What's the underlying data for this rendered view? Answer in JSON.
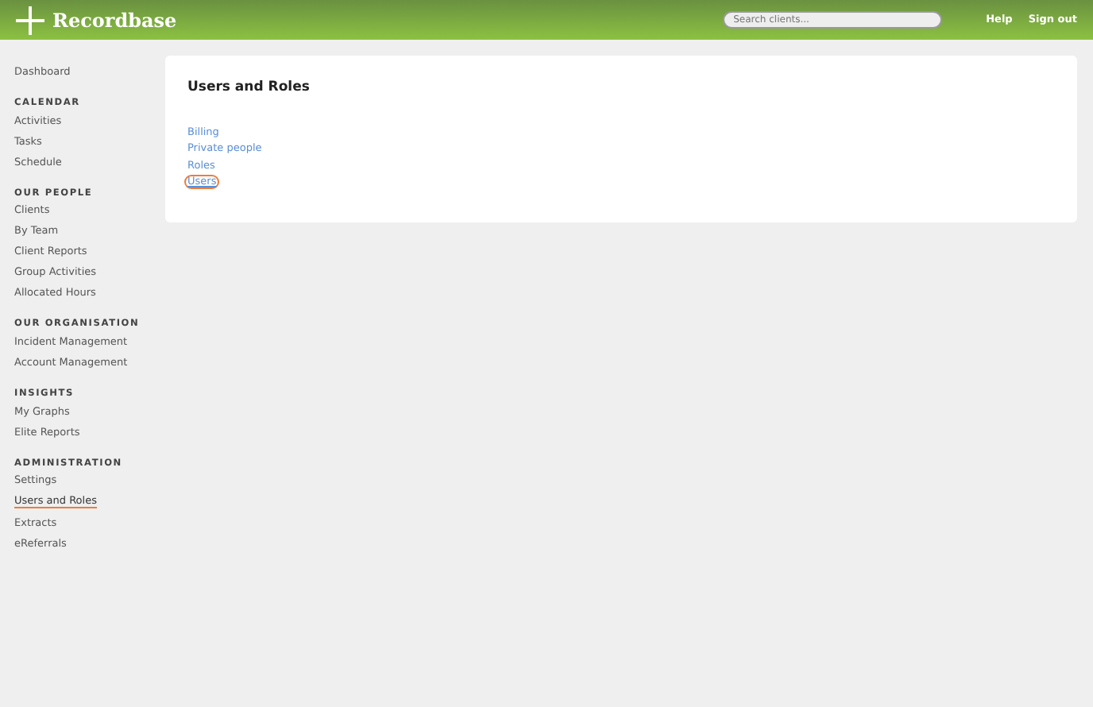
{
  "header": {
    "brand": "Recordbase",
    "search": {
      "placeholder": "Search clients..."
    },
    "links": [
      "Help",
      "Sign out"
    ]
  },
  "sidebar": {
    "sections": [
      {
        "items": [
          {
            "label": "Dashboard",
            "selected": false
          }
        ]
      },
      {
        "heading": "CALENDAR",
        "items": [
          {
            "label": "Activities",
            "selected": false
          },
          {
            "label": "Tasks",
            "selected": false
          },
          {
            "label": "Schedule",
            "selected": false
          }
        ]
      },
      {
        "heading": "OUR PEOPLE",
        "items": [
          {
            "label": "Clients",
            "selected": false
          },
          {
            "label": "By Team",
            "selected": false
          },
          {
            "label": "Client Reports",
            "selected": false
          },
          {
            "label": "Group Activities",
            "selected": false
          },
          {
            "label": "Allocated Hours",
            "selected": false
          }
        ]
      },
      {
        "heading": "OUR ORGANISATION",
        "items": [
          {
            "label": "Incident Management",
            "selected": false
          },
          {
            "label": "Account Management",
            "selected": false
          }
        ]
      },
      {
        "heading": "INSIGHTS",
        "items": [
          {
            "label": "My Graphs",
            "selected": false
          },
          {
            "label": "Elite Reports",
            "selected": false
          }
        ]
      },
      {
        "heading": "ADMINISTRATION",
        "items": [
          {
            "label": "Settings",
            "selected": false
          },
          {
            "label": "Users and Roles",
            "selected": true
          },
          {
            "label": "Extracts",
            "selected": false
          },
          {
            "label": "eReferrals",
            "selected": false
          }
        ]
      }
    ]
  },
  "main": {
    "title": "Users and Roles",
    "links": [
      {
        "label": "Billing",
        "highlighted": false
      },
      {
        "label": "Private people",
        "highlighted": false
      },
      {
        "label": "Roles",
        "highlighted": false
      },
      {
        "label": "Users",
        "highlighted": true
      }
    ]
  }
}
